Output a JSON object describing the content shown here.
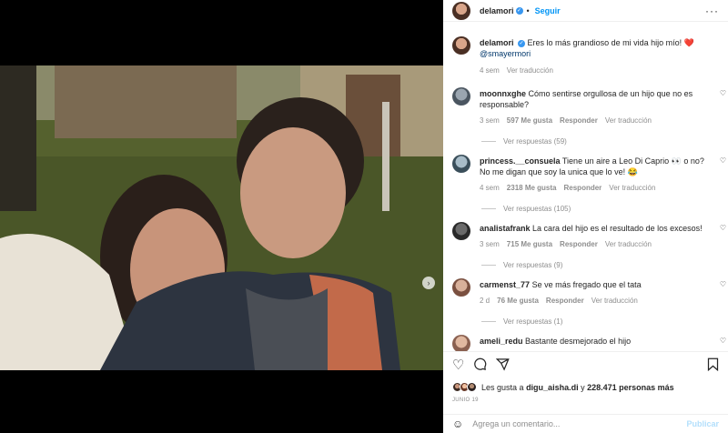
{
  "header": {
    "username": "delamori",
    "follow_label": "Seguir",
    "separator": "•",
    "more": "···"
  },
  "caption": {
    "username": "delamori",
    "text": "Eres lo más grandioso de mi vida hijo mío! ❤️",
    "mention": "@smayermori",
    "time": "4 sem",
    "translate": "Ver traducción"
  },
  "comments": [
    {
      "username": "moonnxghe",
      "text": "Cómo sentirse orgullosa de un hijo que no es responsable?",
      "time": "3 sem",
      "likes": "597 Me gusta",
      "reply": "Responder",
      "translate": "Ver traducción",
      "replies": "Ver respuestas (59)"
    },
    {
      "username": "princess.__consuela",
      "text": "Tiene un aire a Leo Di Caprio 👀 o no? No me digan que soy la unica que lo ve! 😂",
      "time": "4 sem",
      "likes": "2318 Me gusta",
      "reply": "Responder",
      "translate": "Ver traducción",
      "replies": "Ver respuestas (105)"
    },
    {
      "username": "analistafrank",
      "text": "La cara del hijo es el resultado de los excesos!",
      "time": "3 sem",
      "likes": "715 Me gusta",
      "reply": "Responder",
      "translate": "Ver traducción",
      "replies": "Ver respuestas (9)"
    },
    {
      "username": "carmenst_77",
      "text": "Se ve más fregado que el tata",
      "time": "2 d",
      "likes": "76 Me gusta",
      "reply": "Responder",
      "translate": "Ver traducción",
      "replies": "Ver respuestas (1)"
    },
    {
      "username": "ameli_redu",
      "text": "Bastante desmejorado el hijo",
      "time": "",
      "likes": "",
      "reply": "",
      "translate": "",
      "replies": ""
    }
  ],
  "likes": {
    "prefix": "Les gusta a",
    "user": "digu_aisha.di",
    "middle": "y",
    "count": "228.471 personas más"
  },
  "date": "JUNIO 19",
  "add_comment": {
    "placeholder": "Agrega un comentario...",
    "publish": "Publicar"
  },
  "icons": {
    "like": "heart-icon",
    "comment": "comment-icon",
    "share": "share-icon",
    "save": "bookmark-icon",
    "emoji": "emoji-icon",
    "verified": "verified-badge-icon",
    "next": "chevron-right-icon"
  },
  "colors": {
    "accent": "#0095f6",
    "verified": "#3897f0",
    "muted": "#8e8e8e"
  }
}
